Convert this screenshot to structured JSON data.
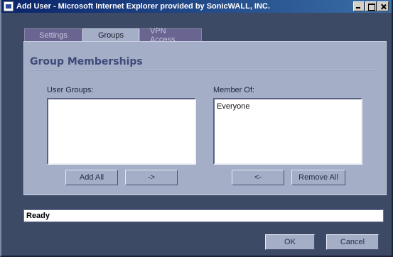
{
  "window": {
    "title": "Add User - Microsoft Internet Explorer provided by SonicWALL, INC."
  },
  "tabs": [
    {
      "label": "Settings",
      "active": false
    },
    {
      "label": "Groups",
      "active": true
    },
    {
      "label": "VPN Access",
      "active": false
    }
  ],
  "section": {
    "title": "Group Memberships"
  },
  "user_groups": {
    "label": "User Groups:",
    "items": []
  },
  "member_of": {
    "label": "Member Of:",
    "items": [
      "Everyone"
    ]
  },
  "buttons": {
    "add_all": "Add All",
    "add": "->",
    "remove": "<-",
    "remove_all": "Remove All",
    "ok": "OK",
    "cancel": "Cancel"
  },
  "status": {
    "text": "Ready"
  },
  "colors": {
    "background": "#3d4a66",
    "panel": "#a4aec6",
    "title_accent": "#3e4a78",
    "inactive_tab": "#6a6490"
  }
}
